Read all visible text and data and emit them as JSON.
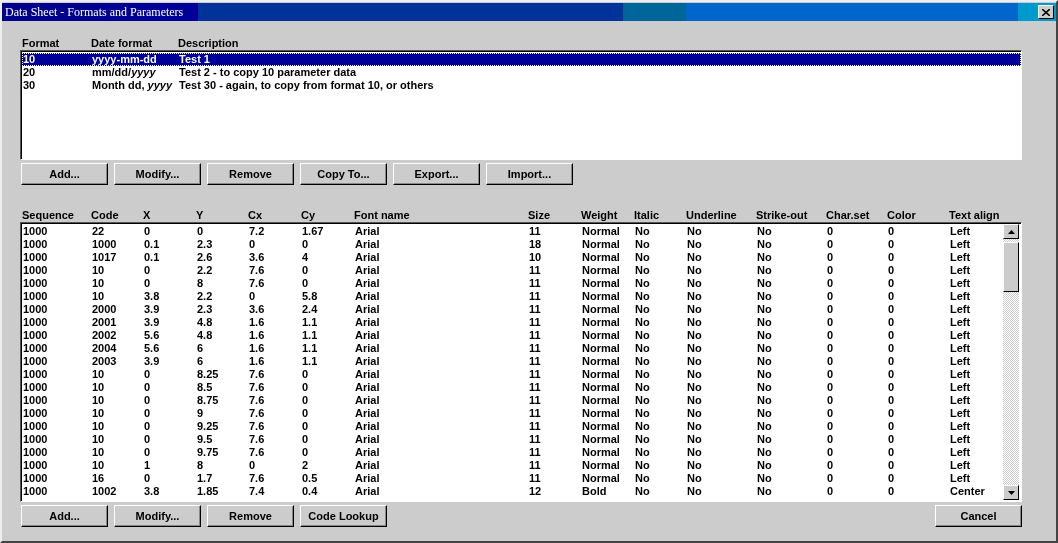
{
  "window": {
    "title": "Data Sheet - Formats and Parameters"
  },
  "formats": {
    "columns": [
      "Format",
      "Date format",
      "Description"
    ],
    "rows": [
      {
        "cells": [
          "10",
          "yyyy-mm-dd",
          "Test 1"
        ],
        "selected": true
      },
      {
        "cells": [
          "20",
          "mm/dd/*yyyy*",
          "Test 2 - to copy 10 parameter data"
        ],
        "selected": false
      },
      {
        "cells": [
          "30",
          "Month dd, *yyyy*",
          "Test 30 - again, to copy from format 10, or others"
        ],
        "selected": false
      }
    ],
    "buttons": [
      "Add...",
      "Modify...",
      "Remove",
      "Copy To...",
      "Export...",
      "Import..."
    ]
  },
  "parameters": {
    "columns": [
      "Sequence",
      "Code",
      "X",
      "Y",
      "Cx",
      "Cy",
      "Font name",
      "Size",
      "Weight",
      "Italic",
      "Underline",
      "Strike-out",
      "Char.set",
      "Color",
      "Text align"
    ],
    "rows": [
      {
        "cells": [
          "1000",
          "22",
          "0",
          "0",
          "7.2",
          "1.67",
          "Arial",
          "11",
          "Normal",
          "No",
          "No",
          "No",
          "0",
          "0",
          "Left"
        ],
        "selected": false
      },
      {
        "cells": [
          "1000",
          "1000",
          "0.1",
          "2.3",
          "0",
          "0",
          "Arial",
          "18",
          "Normal",
          "No",
          "No",
          "No",
          "0",
          "0",
          "Left"
        ],
        "selected": false
      },
      {
        "cells": [
          "1000",
          "1017",
          "0.1",
          "2.6",
          "3.6",
          "4",
          "Arial",
          "10",
          "Normal",
          "No",
          "No",
          "No",
          "0",
          "0",
          "Left"
        ],
        "selected": false
      },
      {
        "cells": [
          "1000",
          "10",
          "0",
          "2.2",
          "7.6",
          "0",
          "Arial",
          "11",
          "Normal",
          "No",
          "No",
          "No",
          "0",
          "0",
          "Left"
        ],
        "selected": false
      },
      {
        "cells": [
          "1000",
          "10",
          "0",
          "8",
          "7.6",
          "0",
          "Arial",
          "11",
          "Normal",
          "No",
          "No",
          "No",
          "0",
          "0",
          "Left"
        ],
        "selected": false
      },
      {
        "cells": [
          "1000",
          "10",
          "3.8",
          "2.2",
          "0",
          "5.8",
          "Arial",
          "11",
          "Normal",
          "No",
          "No",
          "No",
          "0",
          "0",
          "Left"
        ],
        "selected": false
      },
      {
        "cells": [
          "1000",
          "2000",
          "3.9",
          "2.3",
          "3.6",
          "2.4",
          "Arial",
          "11",
          "Normal",
          "No",
          "No",
          "No",
          "0",
          "0",
          "Left"
        ],
        "selected": false
      },
      {
        "cells": [
          "1000",
          "2001",
          "3.9",
          "4.8",
          "1.6",
          "1.1",
          "Arial",
          "11",
          "Normal",
          "No",
          "No",
          "No",
          "0",
          "0",
          "Left"
        ],
        "selected": false
      },
      {
        "cells": [
          "1000",
          "2002",
          "5.6",
          "4.8",
          "1.6",
          "1.1",
          "Arial",
          "11",
          "Normal",
          "No",
          "No",
          "No",
          "0",
          "0",
          "Left"
        ],
        "selected": false
      },
      {
        "cells": [
          "1000",
          "2004",
          "5.6",
          "6",
          "1.6",
          "1.1",
          "Arial",
          "11",
          "Normal",
          "No",
          "No",
          "No",
          "0",
          "0",
          "Left"
        ],
        "selected": false
      },
      {
        "cells": [
          "1000",
          "2003",
          "3.9",
          "6",
          "1.6",
          "1.1",
          "Arial",
          "11",
          "Normal",
          "No",
          "No",
          "No",
          "0",
          "0",
          "Left"
        ],
        "selected": false
      },
      {
        "cells": [
          "1000",
          "10",
          "0",
          "8.25",
          "7.6",
          "0",
          "Arial",
          "11",
          "Normal",
          "No",
          "No",
          "No",
          "0",
          "0",
          "Left"
        ],
        "selected": false
      },
      {
        "cells": [
          "1000",
          "10",
          "0",
          "8.5",
          "7.6",
          "0",
          "Arial",
          "11",
          "Normal",
          "No",
          "No",
          "No",
          "0",
          "0",
          "Left"
        ],
        "selected": false
      },
      {
        "cells": [
          "1000",
          "10",
          "0",
          "8.75",
          "7.6",
          "0",
          "Arial",
          "11",
          "Normal",
          "No",
          "No",
          "No",
          "0",
          "0",
          "Left"
        ],
        "selected": false
      },
      {
        "cells": [
          "1000",
          "10",
          "0",
          "9",
          "7.6",
          "0",
          "Arial",
          "11",
          "Normal",
          "No",
          "No",
          "No",
          "0",
          "0",
          "Left"
        ],
        "selected": false
      },
      {
        "cells": [
          "1000",
          "10",
          "0",
          "9.25",
          "7.6",
          "0",
          "Arial",
          "11",
          "Normal",
          "No",
          "No",
          "No",
          "0",
          "0",
          "Left"
        ],
        "selected": false
      },
      {
        "cells": [
          "1000",
          "10",
          "0",
          "9.5",
          "7.6",
          "0",
          "Arial",
          "11",
          "Normal",
          "No",
          "No",
          "No",
          "0",
          "0",
          "Left"
        ],
        "selected": false
      },
      {
        "cells": [
          "1000",
          "10",
          "0",
          "9.75",
          "7.6",
          "0",
          "Arial",
          "11",
          "Normal",
          "No",
          "No",
          "No",
          "0",
          "0",
          "Left"
        ],
        "selected": false
      },
      {
        "cells": [
          "1000",
          "10",
          "1",
          "8",
          "0",
          "2",
          "Arial",
          "11",
          "Normal",
          "No",
          "No",
          "No",
          "0",
          "0",
          "Left"
        ],
        "selected": false
      },
      {
        "cells": [
          "1000",
          "16",
          "0",
          "1.7",
          "7.6",
          "0.5",
          "Arial",
          "11",
          "Normal",
          "No",
          "No",
          "No",
          "0",
          "0",
          "Left"
        ],
        "selected": false
      },
      {
        "cells": [
          "1000",
          "1002",
          "3.8",
          "1.85",
          "7.4",
          "0.4",
          "Arial",
          "12",
          "Bold",
          "No",
          "No",
          "No",
          "0",
          "0",
          "Center"
        ],
        "selected": false
      }
    ],
    "buttons": [
      "Add...",
      "Modify...",
      "Remove",
      "Code Lookup"
    ],
    "cancel": "Cancel"
  }
}
